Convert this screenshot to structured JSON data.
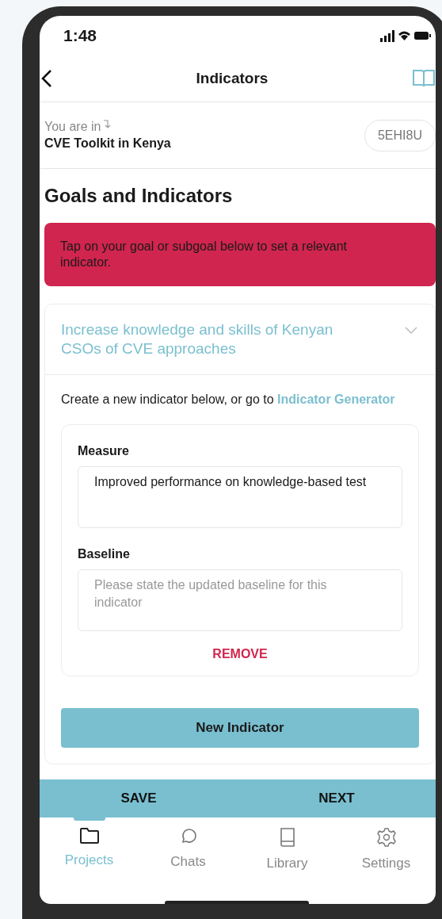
{
  "status_bar": {
    "time": "1:48"
  },
  "header": {
    "title": "Indicators"
  },
  "context": {
    "label": "You are in",
    "project": "CVE Toolkit in Kenya",
    "code": "5EHI8U"
  },
  "page_title": "Goals and Indicators",
  "alert": "Tap on your goal or subgoal below to set a relevant indicator.",
  "goal": {
    "title": "Increase knowledge and skills of Kenyan CSOs of CVE approaches",
    "expanded": true,
    "intro": "Create a new indicator below, or go to",
    "link": "Indicator Generator",
    "indicators": [
      {
        "fields": [
          {
            "label": "Measure",
            "value": "Improved performance on knowledge-based test"
          },
          {
            "label": "Baseline",
            "placeholder": "Please state the updated baseline for this indicator"
          }
        ],
        "remove": "REMOVE"
      }
    ]
  },
  "new_button": "New Indicator",
  "actions": [
    "SAVE",
    "NEXT"
  ],
  "tabs": [
    {
      "label": "Projects",
      "kind": "folder",
      "selected": true
    },
    {
      "label": "Chats",
      "kind": "chat",
      "selected": false
    },
    {
      "label": "Library",
      "kind": "book",
      "selected": false
    },
    {
      "label": "Settings",
      "kind": "gear",
      "selected": false
    }
  ]
}
